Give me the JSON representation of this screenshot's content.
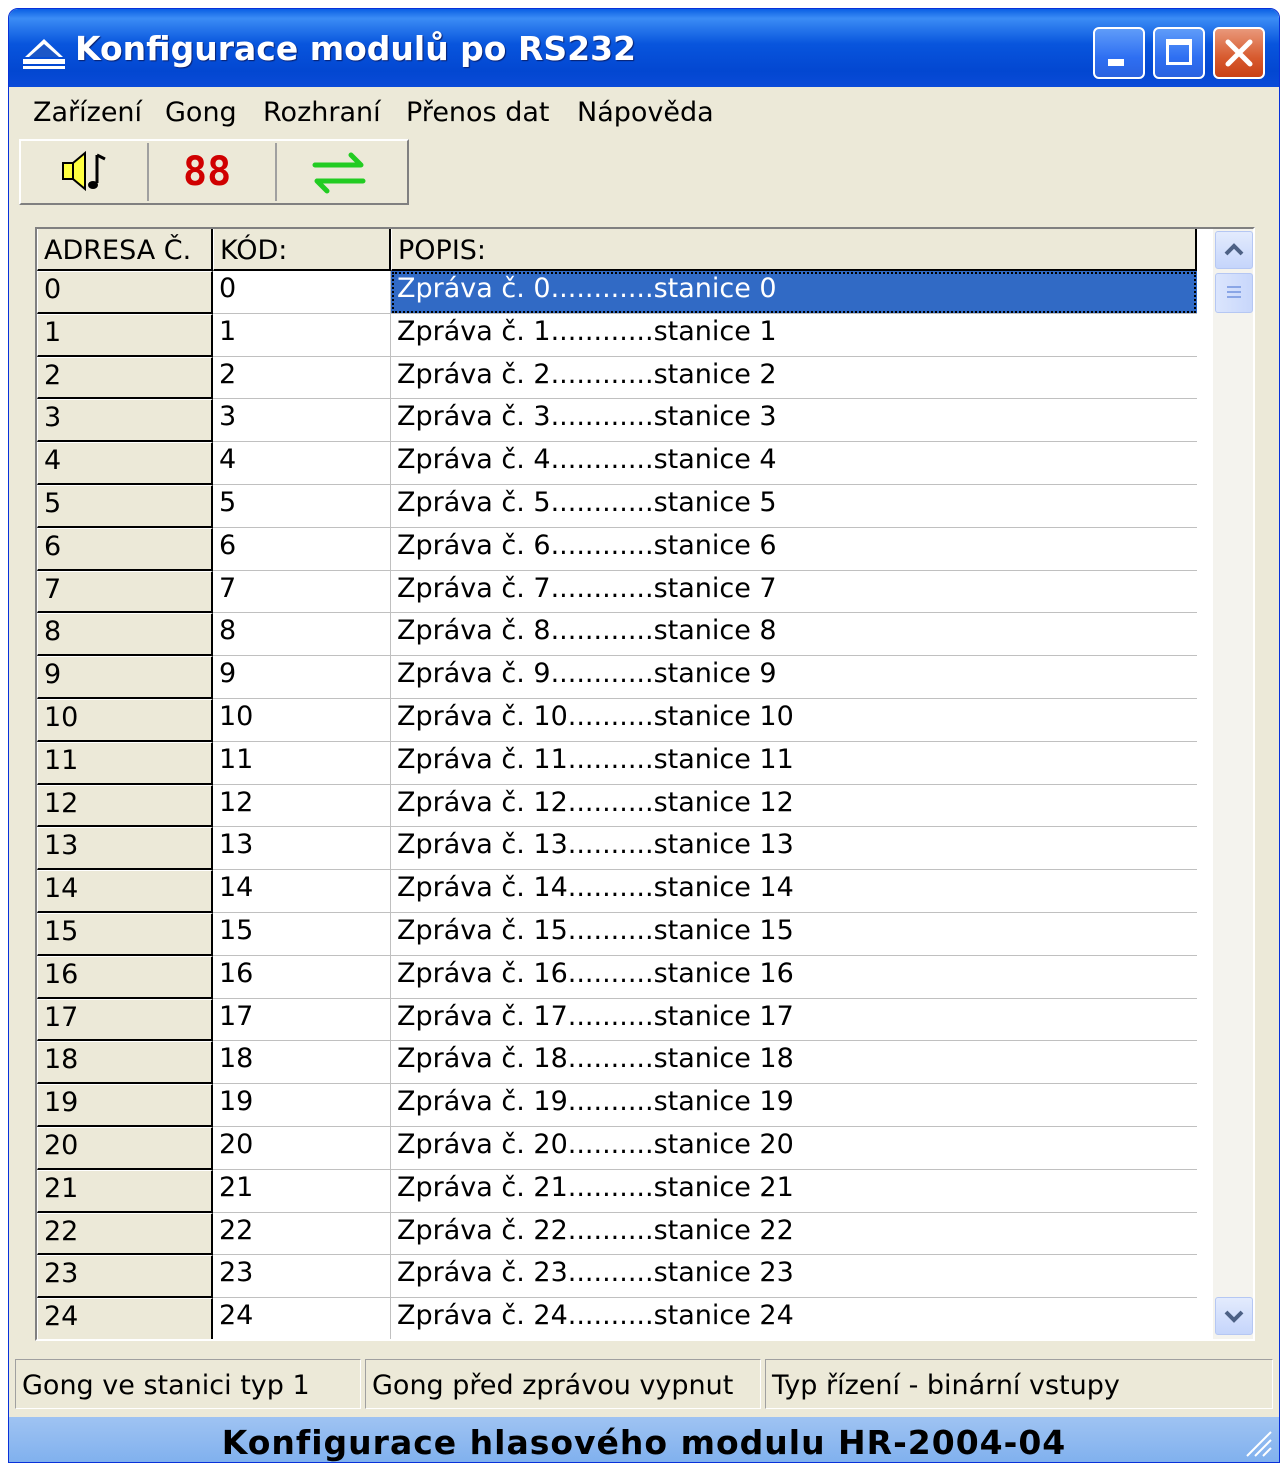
{
  "window": {
    "title": "Konfigurace modulů po RS232",
    "app_icon": "boat-icon",
    "controls": [
      "minimize-icon",
      "maximize-icon",
      "close-icon"
    ]
  },
  "menu": [
    {
      "label": "Zařízení"
    },
    {
      "label": "Gong"
    },
    {
      "label": "Rozhraní"
    },
    {
      "label": "Přenos dat"
    },
    {
      "label": "Nápověda"
    }
  ],
  "toolbar": {
    "gong_icon": "speaker-note-icon",
    "display_text": "88",
    "transfer_icon": "swap-arrows-icon",
    "colors": {
      "display": "#d00000",
      "transfer": "#22cc22",
      "speaker": "#ffff40"
    }
  },
  "grid": {
    "headers": {
      "address": "ADRESA Č.",
      "code": "KÓD:",
      "description": "POPIS:"
    },
    "selected_row": 0,
    "rows": [
      {
        "address": "0",
        "code": "0",
        "description": "Zpráva č. 0............stanice 0"
      },
      {
        "address": "1",
        "code": "1",
        "description": "Zpráva č. 1............stanice 1"
      },
      {
        "address": "2",
        "code": "2",
        "description": "Zpráva č. 2............stanice 2"
      },
      {
        "address": "3",
        "code": "3",
        "description": "Zpráva č. 3............stanice 3"
      },
      {
        "address": "4",
        "code": "4",
        "description": "Zpráva č. 4............stanice 4"
      },
      {
        "address": "5",
        "code": "5",
        "description": "Zpráva č. 5............stanice 5"
      },
      {
        "address": "6",
        "code": "6",
        "description": "Zpráva č. 6............stanice 6"
      },
      {
        "address": "7",
        "code": "7",
        "description": "Zpráva č. 7............stanice 7"
      },
      {
        "address": "8",
        "code": "8",
        "description": "Zpráva č. 8............stanice 8"
      },
      {
        "address": "9",
        "code": "9",
        "description": "Zpráva č. 9............stanice 9"
      },
      {
        "address": "10",
        "code": "10",
        "description": "Zpráva č. 10..........stanice 10"
      },
      {
        "address": "11",
        "code": "11",
        "description": "Zpráva č. 11..........stanice 11"
      },
      {
        "address": "12",
        "code": "12",
        "description": "Zpráva č. 12..........stanice 12"
      },
      {
        "address": "13",
        "code": "13",
        "description": "Zpráva č. 13..........stanice 13"
      },
      {
        "address": "14",
        "code": "14",
        "description": "Zpráva č. 14..........stanice 14"
      },
      {
        "address": "15",
        "code": "15",
        "description": "Zpráva č. 15..........stanice 15"
      },
      {
        "address": "16",
        "code": "16",
        "description": "Zpráva č. 16..........stanice 16"
      },
      {
        "address": "17",
        "code": "17",
        "description": "Zpráva č. 17..........stanice 17"
      },
      {
        "address": "18",
        "code": "18",
        "description": "Zpráva č. 18..........stanice 18"
      },
      {
        "address": "19",
        "code": "19",
        "description": "Zpráva č. 19..........stanice 19"
      },
      {
        "address": "20",
        "code": "20",
        "description": "Zpráva č. 20..........stanice 20"
      },
      {
        "address": "21",
        "code": "21",
        "description": "Zpráva č. 21..........stanice 21"
      },
      {
        "address": "22",
        "code": "22",
        "description": "Zpráva č. 22..........stanice 22"
      },
      {
        "address": "23",
        "code": "23",
        "description": "Zpráva č. 23..........stanice 23"
      },
      {
        "address": "24",
        "code": "24",
        "description": "Zpráva č. 24..........stanice 24"
      }
    ]
  },
  "statusbar": {
    "gong_station": "Gong ve stanici typ 1",
    "gong_before": "Gong před zprávou vypnut",
    "control_type": "Typ řízení - binární vstupy"
  },
  "footer": {
    "text": "Konfigurace hlasového modulu HR-2004-04"
  }
}
